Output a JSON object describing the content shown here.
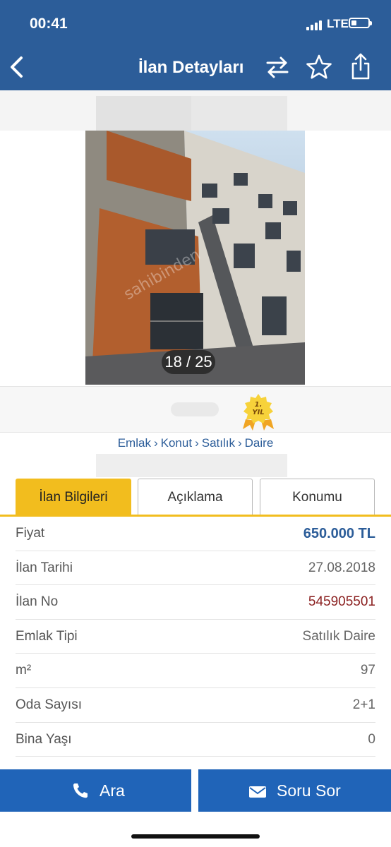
{
  "status_bar": {
    "time": "00:41",
    "network": "LTE"
  },
  "nav": {
    "title": "İlan Detayları"
  },
  "gallery": {
    "counter": "18 / 25",
    "watermark": "sahibinden"
  },
  "badge": {
    "line1": "1.",
    "line2": "YIL"
  },
  "breadcrumb": {
    "items": [
      "Emlak",
      "Konut",
      "Satılık",
      "Daire"
    ],
    "separator": "›"
  },
  "tabs": [
    {
      "label": "İlan Bilgileri",
      "active": true
    },
    {
      "label": "Açıklama",
      "active": false
    },
    {
      "label": "Konumu",
      "active": false
    }
  ],
  "info_rows": [
    {
      "label": "Fiyat",
      "value": "650.000 TL"
    },
    {
      "label": "İlan Tarihi",
      "value": "27.08.2018"
    },
    {
      "label": "İlan No",
      "value": "545905501"
    },
    {
      "label": "Emlak Tipi",
      "value": "Satılık Daire"
    },
    {
      "label": "m²",
      "value": "97"
    },
    {
      "label": "Oda Sayısı",
      "value": "2+1"
    },
    {
      "label": "Bina Yaşı",
      "value": "0"
    }
  ],
  "actions": {
    "call_label": "Ara",
    "ask_label": "Soru Sor"
  },
  "colors": {
    "brand_blue": "#2c5d99",
    "button_blue": "#2064b8",
    "tab_yellow": "#f2bd1e",
    "price_blue": "#2c5d99",
    "listing_no_red": "#8a1f1f"
  }
}
